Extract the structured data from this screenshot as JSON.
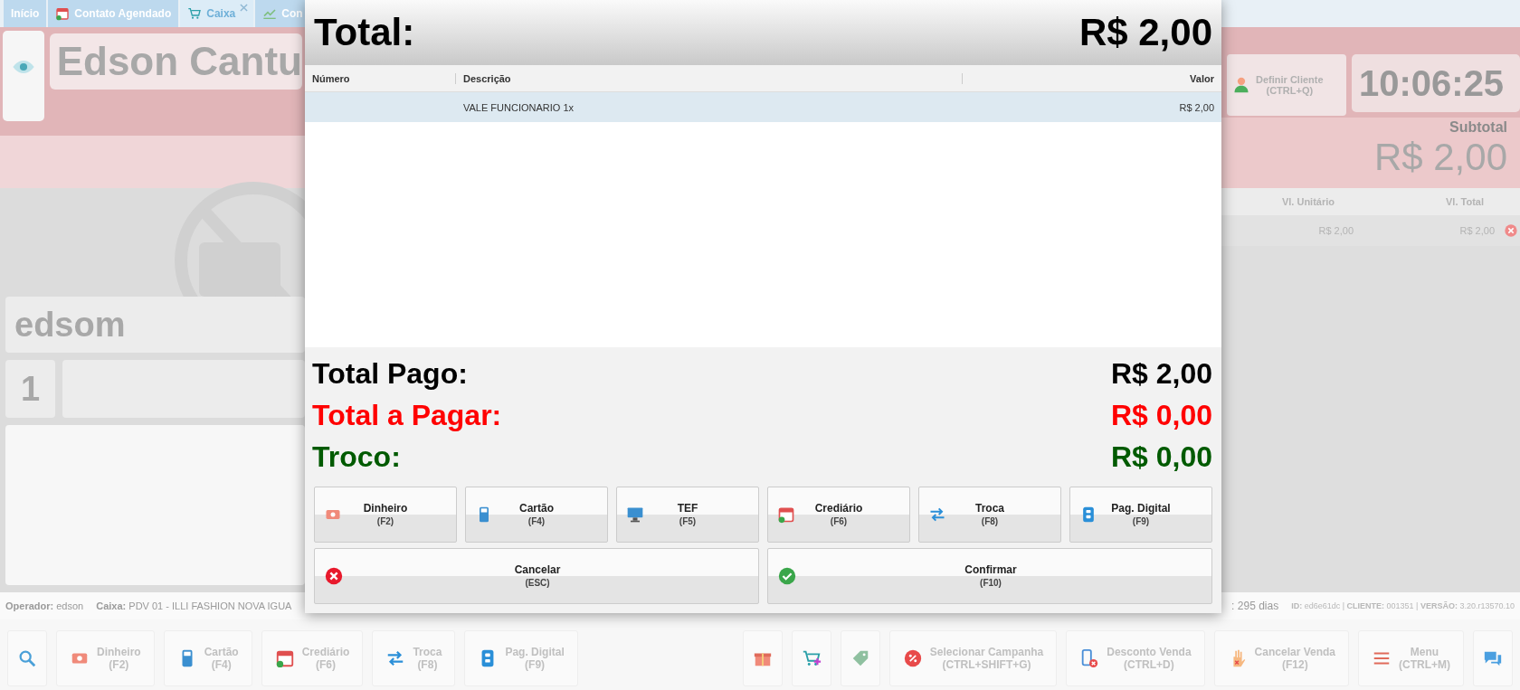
{
  "background": {
    "tabs": [
      {
        "label": "Início",
        "kind": "plain",
        "selected": false
      },
      {
        "label": "Contato Agendado",
        "kind": "calendar",
        "selected": false
      },
      {
        "label": "Caixa",
        "kind": "cart",
        "selected": true,
        "closable": true
      },
      {
        "label": "Con",
        "kind": "chart",
        "selected": false
      }
    ],
    "customer_name": "Edson Cantu",
    "define_client": {
      "label": "Definir Cliente",
      "shortcut": "(CTRL+Q)"
    },
    "clock": "10:06:25",
    "subtotal_label": "Subtotal",
    "subtotal": "R$ 2,00",
    "item_columns": [
      "Vl. Unitário",
      "Vl. Total"
    ],
    "item_rows": [
      [
        "R$ 2,00",
        "R$ 2,00"
      ]
    ],
    "seller_field": "edsom",
    "quantity_field": "1",
    "status": {
      "operator": "**Operador:** edson",
      "till": "**Caixa:** PDV 01 - ILLI FASHION NOVA IGUA",
      "days": ": 295 dias",
      "version": "**ID:** ed6e61dc | **CLIENTE:** 001351 | **VERSÃO:** 3.20.r13570.10"
    },
    "toolbar_left": [
      {
        "kind": "search"
      },
      {
        "kind": "cash",
        "label": "Dinheiro",
        "shortcut": "(F2)"
      },
      {
        "kind": "card",
        "label": "Cartão",
        "shortcut": "(F4)"
      },
      {
        "kind": "calendar",
        "label": "Crediário",
        "shortcut": "(F6)"
      },
      {
        "kind": "swap",
        "label": "Troca",
        "shortcut": "(F8)"
      },
      {
        "kind": "digital",
        "label": "Pag. Digital",
        "shortcut": "(F9)"
      }
    ],
    "toolbar_right": [
      {
        "kind": "gift"
      },
      {
        "kind": "cartplus"
      },
      {
        "kind": "tag"
      },
      {
        "kind": "percent",
        "label": "Selecionar Campanha",
        "shortcut": "(CTRL+SHIFT+G)"
      },
      {
        "kind": "discount",
        "label": "Desconto Venda",
        "shortcut": "(CTRL+D)"
      },
      {
        "kind": "hand",
        "label": "Cancelar Venda",
        "shortcut": "(F12)"
      },
      {
        "kind": "menu",
        "label": "Menu",
        "shortcut": "(CTRL+M)"
      },
      {
        "kind": "chat"
      }
    ]
  },
  "modal": {
    "total_label": "Total:",
    "total": "R$ 2,00",
    "columns": [
      "Número",
      "Descrição",
      "Valor"
    ],
    "rows": [
      {
        "description": "VALE FUNCIONARIO 1x",
        "value": "R$ 2,00",
        "selected": true
      }
    ],
    "summary": [
      {
        "label": "Total Pago:",
        "value": "R$ 2,00",
        "color": "#000000"
      },
      {
        "label": "Total a Pagar:",
        "value": "R$ 0,00",
        "color": "#ff0000"
      },
      {
        "label": "Troco:",
        "value": "R$ 0,00",
        "color": "#005a00"
      }
    ],
    "payment_buttons": [
      {
        "kind": "cash",
        "label": "Dinheiro",
        "shortcut": "(F2)"
      },
      {
        "kind": "card",
        "label": "Cartão",
        "shortcut": "(F4)"
      },
      {
        "kind": "tef",
        "label": "TEF",
        "shortcut": "(F5)"
      },
      {
        "kind": "calendar",
        "label": "Crediário",
        "shortcut": "(F6)"
      },
      {
        "kind": "swap",
        "label": "Troca",
        "shortcut": "(F8)"
      },
      {
        "kind": "digital",
        "label": "Pag. Digital",
        "shortcut": "(F9)"
      }
    ],
    "action_buttons": [
      {
        "kind": "cancel",
        "label": "Cancelar",
        "shortcut": "(ESC)"
      },
      {
        "kind": "confirm",
        "label": "Confirmar",
        "shortcut": "(F10)"
      }
    ]
  }
}
